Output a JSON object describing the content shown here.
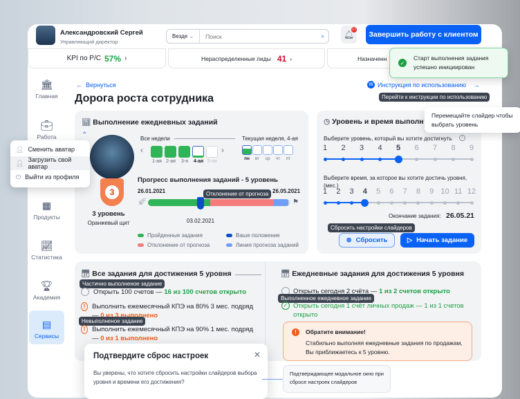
{
  "header": {
    "user_name": "Александровский Сергей",
    "user_role": "Управляющий директор",
    "search_scope": "Везде",
    "search_placeholder": "Поиск",
    "notifications_count": "17",
    "finish_button": "Завершить работу с клиентом"
  },
  "kpi": [
    {
      "label": "KPI по Р/С",
      "value": "57%"
    },
    {
      "label": "Нераспределенные лиды",
      "value": "41"
    },
    {
      "label": "Назначенн"
    }
  ],
  "toast": {
    "text": "Старт выполнения задания успешно инициирован"
  },
  "sidebar": {
    "items": [
      {
        "label": "Главная"
      },
      {
        "label": "Работа"
      },
      {
        "label": "Продукты"
      },
      {
        "label": "Статистика"
      },
      {
        "label": "Академия"
      },
      {
        "label": "Сервисы"
      }
    ]
  },
  "avatar_menu": [
    "Сменить аватар",
    "Загрузить свой аватар",
    "Выйти из профиля"
  ],
  "page": {
    "back": "Вернуться",
    "title": "Дорога роста сотрудника",
    "instruction_link": "Инструкция по использованию",
    "instruction_tooltip": "Перейти к инструкции по использованию"
  },
  "daily": {
    "title": "Выполнение ежедневных заданий",
    "all_weeks": "Все недели",
    "current_week": "Текущая неделя, 4-ая",
    "weeks": [
      "1-ая",
      "2-ая",
      "3-я",
      "4-ая",
      "5-ая"
    ],
    "days": [
      "пн",
      "вт",
      "ср",
      "чт",
      "пт"
    ],
    "level": "3",
    "level_label": "3 уровень",
    "shield_name": "Оранжевый щит",
    "progress_title": "Прогресс выполнения заданий - 5 уровень",
    "start_date": "26.01.2021",
    "end_date": "26.05.2021",
    "current_date": "03.02.2021",
    "progress_tooltip": "Отклонение от прогноза",
    "progress": {
      "done": 0.44,
      "deviation": 0.45,
      "forecast": 0.1
    },
    "legend": [
      "Пройденные задания",
      "Ваше положение",
      "Отклонение от прогноза",
      "Линия прогноза заданий"
    ]
  },
  "level_time": {
    "title": "Уровень и время выполн",
    "level_prompt": "Выберите уровень, который вы хотите достигнуть",
    "levels": [
      "1",
      "2",
      "3",
      "4",
      "5",
      "6",
      "7",
      "8",
      "9"
    ],
    "selected_level": 5,
    "time_prompt": "Выберите время, за которое вы хотите достичь уровня, (мес.)",
    "months": [
      "1",
      "2",
      "3",
      "4",
      "5",
      "6",
      "7",
      "8",
      "9",
      "10",
      "11",
      "12"
    ],
    "selected_month": 4,
    "end_label": "Окончание задания:",
    "end_value": "26.05.21",
    "reset_tooltip": "Сбросить настройки слайдеров",
    "reset": "Сбросить",
    "start": "Начать задание",
    "slider_tooltip": "Перемещайте слайдер чтобы выбрать уровень"
  },
  "all_tasks": {
    "title": "Все задания для достижения 5 уровня",
    "tip_partial": "Частично выполненое задание",
    "tip_failed": "Невыполненое задание",
    "items": [
      {
        "text": "Открыть 100 счетов — ",
        "status": "16 из 100 счетов открыто"
      },
      {
        "text": "Выполнить ежемесячный КПЭ на 80% 3 мес. подряд — ",
        "status": "0 из 3 выполнено"
      },
      {
        "text": "Выполнить ежемесячный КПЭ на 90% 1 мес. подряд — ",
        "status": "0 из 1 выполнено"
      }
    ]
  },
  "daily_tasks": {
    "title": "Ежедневные задания для достижения 5 уровня",
    "tip_done": "Выполненное ежедневное задание",
    "items": [
      {
        "text": "Открыть сегодня 2 счёта — ",
        "status": "1 из 2 счетов открыто"
      },
      {
        "text": "Открыть сегодня 1 счёт личных продаж — 1 из 1 счетов открыто"
      }
    ],
    "alert_title": "Обратите внимание!",
    "alert_text": "Стабильно выполняя ежедневные задания по продажам, Вы приближаетесь к 5 уровню."
  },
  "modal": {
    "title": "Подтвердите сброс настроек",
    "text": "Вы уверены, что хотите сбросить настройки слайдеров выбора уровня и времени его достижения?",
    "annotation": "Подтверждающее модальное окно при сбросе настроек слайдеров"
  }
}
